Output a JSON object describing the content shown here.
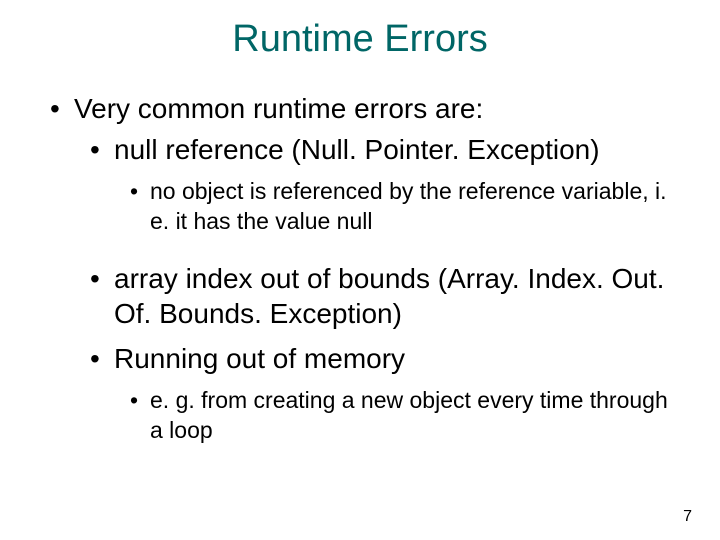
{
  "title": "Runtime Errors",
  "bullets": {
    "l1_a": "Very common runtime errors are:",
    "l2_a": "null reference (Null. Pointer. Exception)",
    "l3_a": "no object is referenced by the reference variable, i. e. it has the value null",
    "l2_b": "array index out of bounds (Array. Index. Out. Of. Bounds. Exception)",
    "l2_c": "Running out of memory",
    "l3_b": "e. g. from creating a new object every time through a loop"
  },
  "page_number": "7"
}
